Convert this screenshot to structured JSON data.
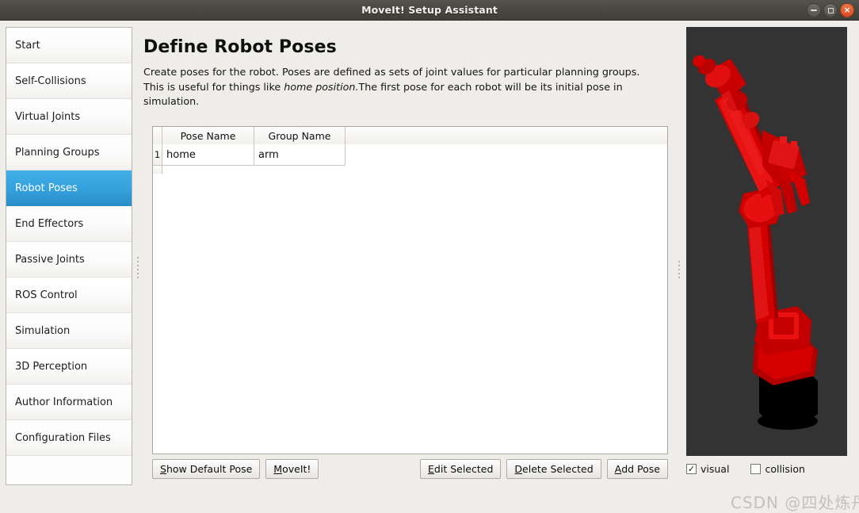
{
  "window": {
    "title": "MoveIt! Setup Assistant",
    "controls": [
      {
        "name": "minimize",
        "glyph": "–"
      },
      {
        "name": "maximize",
        "glyph": "□"
      },
      {
        "name": "close",
        "glyph": "×"
      }
    ]
  },
  "sidebar": {
    "items": [
      {
        "label": "Start",
        "selected": false
      },
      {
        "label": "Self-Collisions",
        "selected": false
      },
      {
        "label": "Virtual Joints",
        "selected": false
      },
      {
        "label": "Planning Groups",
        "selected": false
      },
      {
        "label": "Robot Poses",
        "selected": true
      },
      {
        "label": "End Effectors",
        "selected": false
      },
      {
        "label": "Passive Joints",
        "selected": false
      },
      {
        "label": "ROS Control",
        "selected": false
      },
      {
        "label": "Simulation",
        "selected": false
      },
      {
        "label": "3D Perception",
        "selected": false
      },
      {
        "label": "Author Information",
        "selected": false
      },
      {
        "label": "Configuration Files",
        "selected": false
      }
    ]
  },
  "main": {
    "title": "Define Robot Poses",
    "description_part1": "Create poses for the robot. Poses are defined as sets of joint values for particular planning groups. This is useful for things like ",
    "description_emphasis": "home position.",
    "description_part2": "The first pose for each robot will be its initial pose in simulation.",
    "table": {
      "columns": [
        "Pose Name",
        "Group Name"
      ],
      "rows": [
        {
          "index": "1",
          "pose_name": "home",
          "group_name": "arm"
        }
      ]
    },
    "buttons": {
      "show_default_pose": {
        "accel": "S",
        "rest": "how Default Pose"
      },
      "moveit": {
        "accel": "M",
        "rest": "oveIt!"
      },
      "edit_selected": {
        "accel": "E",
        "rest": "dit Selected"
      },
      "delete_selected": {
        "accel": "D",
        "rest": "elete Selected"
      },
      "add_pose": {
        "accel": "A",
        "rest": "dd Pose"
      }
    }
  },
  "viewport": {
    "background_color": "#333333",
    "robot_color": "#d40000",
    "checkboxes": [
      {
        "label": "visual",
        "checked": true,
        "glyph": "✓"
      },
      {
        "label": "collision",
        "checked": false,
        "glyph": "✓"
      }
    ]
  },
  "watermark": {
    "text": "CSDN @四处炼丹"
  },
  "colors": {
    "titlebar": "#4a4843",
    "accent_selected": "#35a2de",
    "close_button": "#dc4a22",
    "surface": "#efedea"
  }
}
